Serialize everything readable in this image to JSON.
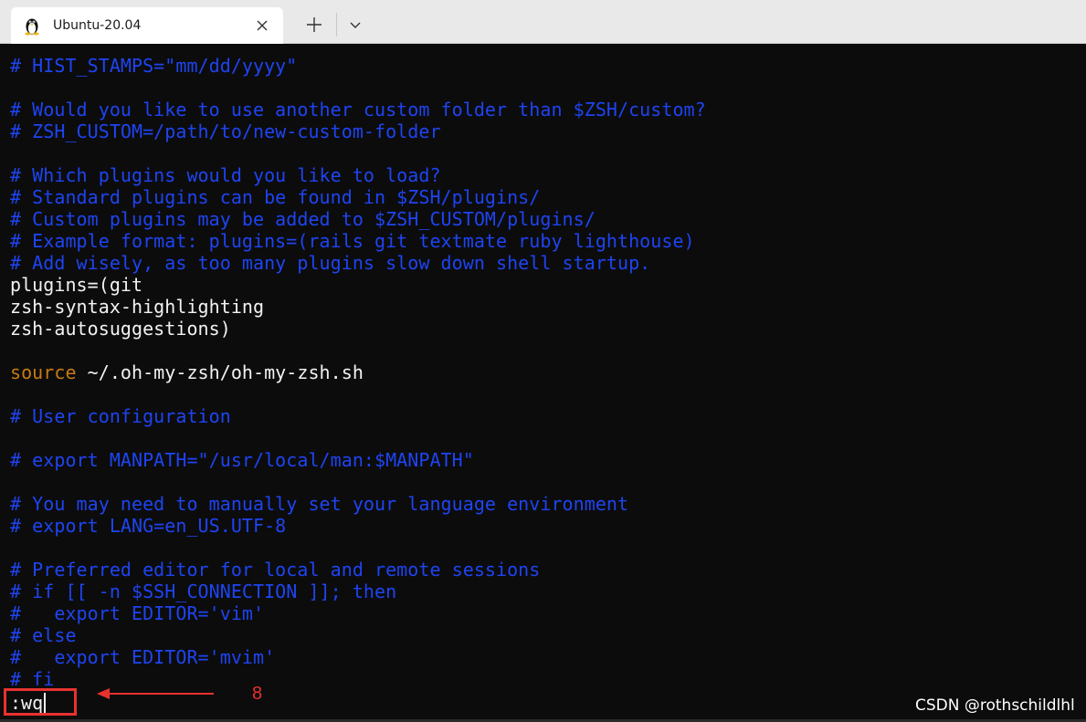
{
  "tab": {
    "title": "Ubuntu-20.04",
    "icon": "linux-penguin-icon"
  },
  "toolbar": {
    "new_tab_icon": "plus-icon",
    "dropdown_icon": "chevron-down-icon",
    "close_icon": "close-icon"
  },
  "colors": {
    "comment": "#1e44f2",
    "text": "#f2f2f2",
    "keyword": "#c77b14",
    "annotation": "#e8322f",
    "background": "#0c0c0c"
  },
  "lines": [
    {
      "text": "# HIST_STAMPS=\"mm/dd/yyyy\"",
      "kind": "comment"
    },
    {
      "text": "",
      "kind": "text"
    },
    {
      "text": "# Would you like to use another custom folder than $ZSH/custom?",
      "kind": "comment"
    },
    {
      "text": "# ZSH_CUSTOM=/path/to/new-custom-folder",
      "kind": "comment"
    },
    {
      "text": "",
      "kind": "text"
    },
    {
      "text": "# Which plugins would you like to load?",
      "kind": "comment"
    },
    {
      "text": "# Standard plugins can be found in $ZSH/plugins/",
      "kind": "comment"
    },
    {
      "text": "# Custom plugins may be added to $ZSH_CUSTOM/plugins/",
      "kind": "comment"
    },
    {
      "text": "# Example format: plugins=(rails git textmate ruby lighthouse)",
      "kind": "comment"
    },
    {
      "text": "# Add wisely, as too many plugins slow down shell startup.",
      "kind": "comment"
    },
    {
      "text": "plugins=(git",
      "kind": "text"
    },
    {
      "text": "zsh-syntax-highlighting",
      "kind": "text"
    },
    {
      "text": "zsh-autosuggestions)",
      "kind": "text"
    },
    {
      "text": "",
      "kind": "text"
    },
    {
      "text": "source",
      "kind": "keyword",
      "rest": " ~/.oh-my-zsh/oh-my-zsh.sh"
    },
    {
      "text": "",
      "kind": "text"
    },
    {
      "text": "# User configuration",
      "kind": "comment"
    },
    {
      "text": "",
      "kind": "text"
    },
    {
      "text": "# export MANPATH=\"/usr/local/man:$MANPATH\"",
      "kind": "comment"
    },
    {
      "text": "",
      "kind": "text"
    },
    {
      "text": "# You may need to manually set your language environment",
      "kind": "comment"
    },
    {
      "text": "# export LANG=en_US.UTF-8",
      "kind": "comment"
    },
    {
      "text": "",
      "kind": "text"
    },
    {
      "text": "# Preferred editor for local and remote sessions",
      "kind": "comment"
    },
    {
      "text": "# if [[ -n $SSH_CONNECTION ]]; then",
      "kind": "comment"
    },
    {
      "text": "#   export EDITOR='vim'",
      "kind": "comment"
    },
    {
      "text": "# else",
      "kind": "comment"
    },
    {
      "text": "#   export EDITOR='mvim'",
      "kind": "comment"
    },
    {
      "text": "# fi",
      "kind": "comment"
    }
  ],
  "command": {
    "text": ":wq"
  },
  "annotation": {
    "number": "8"
  },
  "watermark": {
    "text": "CSDN @rothschildlhl"
  }
}
